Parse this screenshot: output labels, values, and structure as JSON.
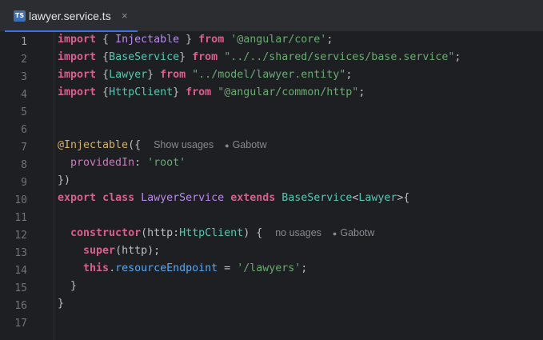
{
  "tab": {
    "icon_text": "TS",
    "filename": "lawyer.service.ts",
    "close_glyph": "×",
    "icon": "typescript-file-icon"
  },
  "colors": {
    "accent": "#3574f0",
    "background": "#1e1f22",
    "tabbar": "#2b2d30"
  },
  "gutter": {
    "line_numbers": [
      "1",
      "2",
      "3",
      "4",
      "5",
      "6",
      "7",
      "8",
      "9",
      "10",
      "11",
      "12",
      "13",
      "14",
      "15",
      "16",
      "17"
    ],
    "current_line": "1"
  },
  "code": {
    "l1": {
      "kw": "import",
      "p1": " { ",
      "name": "Injectable",
      "p2": " } ",
      "from": "from",
      "sp": " ",
      "str": "'@angular/core'",
      "end": ";"
    },
    "l2": {
      "kw": "import",
      "p1": " {",
      "name": "BaseService",
      "p2": "} ",
      "from": "from",
      "sp": " ",
      "str": "\"../../shared/services/base.service\"",
      "end": ";"
    },
    "l3": {
      "kw": "import",
      "p1": " {",
      "name": "Lawyer",
      "p2": "} ",
      "from": "from",
      "sp": " ",
      "str": "\"../model/lawyer.entity\"",
      "end": ";"
    },
    "l4": {
      "kw": "import",
      "p1": " {",
      "name": "HttpClient",
      "p2": "} ",
      "from": "from",
      "sp": " ",
      "str": "\"@angular/common/http\"",
      "end": ";"
    },
    "l7": {
      "ann": "@Injectable",
      "rest": "({",
      "hint_usages": "Show usages",
      "hint_user": "Gabotw"
    },
    "l8": {
      "indent": "  ",
      "prop": "providedIn",
      "colon": ": ",
      "str": "'root'"
    },
    "l9": {
      "text": "})"
    },
    "l10": {
      "kw1": "export",
      "sp1": " ",
      "kw2": "class",
      "sp2": " ",
      "cls": "LawyerService",
      "sp3": " ",
      "kw3": "extends",
      "sp4": " ",
      "base": "BaseService",
      "lt": "<",
      "gen": "Lawyer",
      "gt": ">{"
    },
    "l12": {
      "indent": "  ",
      "kw": "constructor",
      "p1": "(http:",
      "type": "HttpClient",
      "p2": ") {",
      "hint_usages": "no usages",
      "hint_user": "Gabotw"
    },
    "l13": {
      "indent": "    ",
      "kw": "super",
      "rest": "(http);"
    },
    "l14": {
      "indent": "    ",
      "kw": "this",
      "dot": ".",
      "prop": "resourceEndpoint",
      "eq": " = ",
      "str": "'/lawyers'",
      "end": ";"
    },
    "l15": {
      "text": "  }"
    },
    "l16": {
      "text": "}"
    }
  },
  "icons": {
    "user": "user-icon"
  }
}
